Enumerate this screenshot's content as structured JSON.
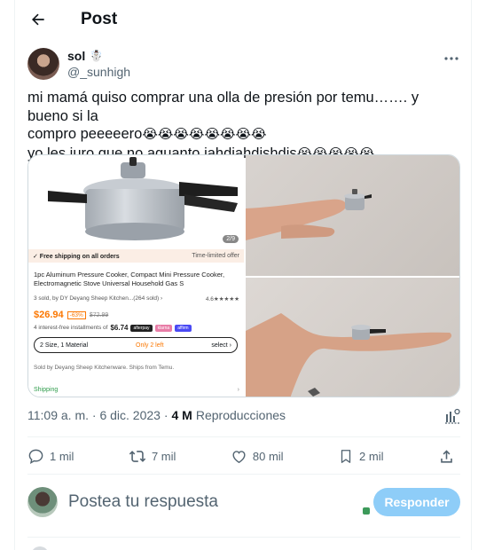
{
  "header": {
    "title": "Post"
  },
  "author": {
    "name": "sol",
    "handle": "@_sunhigh",
    "name_emoji": "☃️"
  },
  "tweet": {
    "line1": "mi mamá quiso comprar una olla de presión por temu……. y bueno si la",
    "line2": "compro peeeeero",
    "line2_emojis": "😭😭😭😭😭😭😭😭",
    "line3": "yo les juro que no aguanto  jahdjahdjshdjs",
    "line3_emojis": "😭😭😭😭😭"
  },
  "product_card": {
    "pager": "2/9",
    "free_shipping": "✓ Free shipping on all orders",
    "time_limited": "Time-limited offer",
    "title": "1pc Aluminum Pressure Cooker, Compact Mini Pressure Cooker, Electromagnetic Stove Universal Household Gas S",
    "sold": "3 sold, by DY Deyang Sheep Kitchen...(264 sold) ›",
    "rating": "4.6★★★★★",
    "price": "$26.94",
    "discount": "-63%",
    "old_price": "$72.99",
    "installments": "4 interest-free installments of",
    "installment_amount": "$6.74",
    "pay_badges": [
      "afterpay",
      "klarna",
      "affirm"
    ],
    "size_label": "2 Size, 1 Material",
    "only_left": "Only 2 left",
    "select": "select ›",
    "sold_by": "Sold by Deyang Sheep Kitchenware. Ships from Temu.",
    "shipping": "Shipping",
    "shipping_arrow": "›"
  },
  "meta": {
    "time": "11:09 a. m. · 6 dic. 2023 ·",
    "views_count": "4 M",
    "views_label": "Reproducciones"
  },
  "actions": {
    "replies": "1 mil",
    "reposts": "7 mil",
    "likes": "80 mil",
    "bookmarks": "2 mil"
  },
  "reply_box": {
    "placeholder": "Postea tu respuesta",
    "button": "Responder"
  },
  "colors": {
    "accent": "#1d9bf0",
    "reply_button": "#8ecdf8",
    "temu_orange": "#fb7701",
    "temu_green": "#2e9c4b"
  }
}
